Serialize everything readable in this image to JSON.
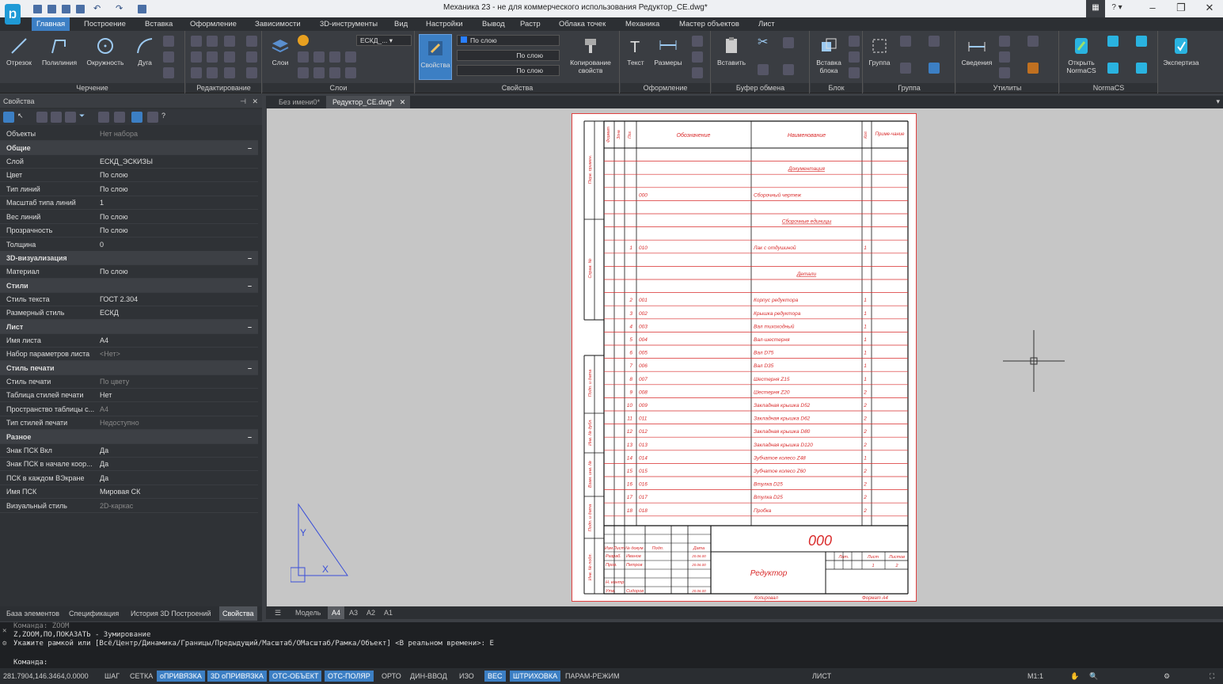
{
  "title": "Механика 23 - не для коммерческого использования Редуктор_CE.dwg*",
  "menu": [
    "Главная",
    "Построение",
    "Вставка",
    "Оформление",
    "Зависимости",
    "3D-инструменты",
    "Вид",
    "Настройки",
    "Вывод",
    "Растр",
    "Облака точек",
    "Механика",
    "Мастер объектов",
    "Лист"
  ],
  "ribbon": {
    "draw": [
      "Отрезок",
      "Полилиния",
      "Окружность",
      "Дуга"
    ],
    "layers_btn": "Слои",
    "layer_value": "ЕСКД_...",
    "prop_btn": "Свойства",
    "combo1": "По слою",
    "combo2": "По слою",
    "combo3": "По слою",
    "copy_props": "Копирование свойств",
    "text": "Текст",
    "dims": "Размеры",
    "paste": "Вставить",
    "block_insert": "Вставка блока",
    "group": "Группа",
    "info": "Сведения",
    "normacs_open": "Открыть NormaCS",
    "expertise": "Экспертиза",
    "groups": [
      "Черчение",
      "Редактирование",
      "Слои",
      "Свойства",
      "Оформление",
      "Буфер обмена",
      "Блок",
      "Группа",
      "Утилиты",
      "NormaCS"
    ]
  },
  "panel": {
    "title": "Свойства",
    "rows": [
      {
        "k": "Объекты",
        "v": "Нет набора",
        "dim": true
      },
      {
        "cat": "Общие"
      },
      {
        "k": "Слой",
        "v": "ЕСКД_ЭСКИЗЫ"
      },
      {
        "k": "Цвет",
        "v": "По слою"
      },
      {
        "k": "Тип линий",
        "v": "По слою"
      },
      {
        "k": "Масштаб типа линий",
        "v": "1"
      },
      {
        "k": "Вес линий",
        "v": "По слою"
      },
      {
        "k": "Прозрачность",
        "v": "По слою"
      },
      {
        "k": "Толщина",
        "v": "0"
      },
      {
        "cat": "3D-визуализация"
      },
      {
        "k": "Материал",
        "v": "По слою"
      },
      {
        "cat": "Стили"
      },
      {
        "k": "Стиль текста",
        "v": "ГОСТ 2.304"
      },
      {
        "k": "Размерный стиль",
        "v": "ЕСКД"
      },
      {
        "cat": "Лист"
      },
      {
        "k": "Имя листа",
        "v": "A4"
      },
      {
        "k": "Набор параметров листа",
        "v": "<Нет>",
        "dim": true
      },
      {
        "cat": "Стиль печати"
      },
      {
        "k": "Стиль печати",
        "v": "По цвету",
        "dim": true
      },
      {
        "k": "Таблица стилей печати",
        "v": "Нет"
      },
      {
        "k": "Пространство таблицы с...",
        "v": "A4",
        "dim": true
      },
      {
        "k": "Тип стилей печати",
        "v": "Недоступно",
        "dim": true
      },
      {
        "cat": "Разное"
      },
      {
        "k": "Знак ПСК Вкл",
        "v": "Да"
      },
      {
        "k": "Знак ПСК в начале коор...",
        "v": "Да"
      },
      {
        "k": "ПСК в каждом ВЭкране",
        "v": "Да"
      },
      {
        "k": "Имя ПСК",
        "v": "Мировая СК"
      },
      {
        "k": "Визуальный стиль",
        "v": "2D-каркас",
        "dim": true
      }
    ]
  },
  "bottom_tabs": [
    "База элементов",
    "Спецификация",
    "История 3D Построений",
    "Свойства"
  ],
  "doc_tabs": [
    "Без имени0*",
    "Редуктор_CE.dwg*"
  ],
  "layout_tabs": [
    "Модель",
    "A4",
    "A3",
    "A2",
    "A1"
  ],
  "spec": {
    "header": {
      "format": "Формат",
      "zone": "Зона",
      "pos": "Поз.",
      "designation": "Обозначение",
      "name": "Наименование",
      "qty": "Кол.",
      "note": "Приме-чание"
    },
    "rows": [
      {
        "type": "blank"
      },
      {
        "type": "section",
        "name": "Документация"
      },
      {
        "type": "blank"
      },
      {
        "type": "item",
        "pos": "",
        "des": "000",
        "name": "Сборочный чертеж",
        "qty": ""
      },
      {
        "type": "blank"
      },
      {
        "type": "section",
        "name": "Сборочные единицы"
      },
      {
        "type": "blank"
      },
      {
        "type": "item",
        "pos": "1",
        "des": "010",
        "name": "Лак с отдушиной",
        "qty": "1"
      },
      {
        "type": "blank"
      },
      {
        "type": "section",
        "name": "Детали"
      },
      {
        "type": "blank"
      },
      {
        "type": "item",
        "pos": "2",
        "des": "001",
        "name": "Корпус редуктора",
        "qty": "1"
      },
      {
        "type": "item",
        "pos": "3",
        "des": "002",
        "name": "Крышка редуктора",
        "qty": "1"
      },
      {
        "type": "item",
        "pos": "4",
        "des": "003",
        "name": "Вал тихоходный",
        "qty": "1"
      },
      {
        "type": "item",
        "pos": "5",
        "des": "004",
        "name": "Вал-шестерня",
        "qty": "1"
      },
      {
        "type": "item",
        "pos": "6",
        "des": "005",
        "name": "Вал D75",
        "qty": "1"
      },
      {
        "type": "item",
        "pos": "7",
        "des": "006",
        "name": "Вал D35",
        "qty": "1"
      },
      {
        "type": "item",
        "pos": "8",
        "des": "007",
        "name": "Шестерня Z15",
        "qty": "1"
      },
      {
        "type": "item",
        "pos": "9",
        "des": "008",
        "name": "Шестерня Z20",
        "qty": "2"
      },
      {
        "type": "item",
        "pos": "10",
        "des": "009",
        "name": "Закладная крышка D52",
        "qty": "2"
      },
      {
        "type": "item",
        "pos": "11",
        "des": "011",
        "name": "Закладная крышка D62",
        "qty": "2"
      },
      {
        "type": "item",
        "pos": "12",
        "des": "012",
        "name": "Закладная крышка D80",
        "qty": "2"
      },
      {
        "type": "item",
        "pos": "13",
        "des": "013",
        "name": "Закладная крышка D120",
        "qty": "2"
      },
      {
        "type": "item",
        "pos": "14",
        "des": "014",
        "name": "Зубчатое колесо Z48",
        "qty": "1"
      },
      {
        "type": "item",
        "pos": "15",
        "des": "015",
        "name": "Зубчатое колесо Z60",
        "qty": "2"
      },
      {
        "type": "item",
        "pos": "16",
        "des": "016",
        "name": "Втулка D25",
        "qty": "2"
      },
      {
        "type": "item",
        "pos": "17",
        "des": "017",
        "name": "Втулка D25",
        "qty": "2"
      },
      {
        "type": "item",
        "pos": "18",
        "des": "018",
        "name": "Пробка",
        "qty": "2"
      }
    ],
    "side": [
      "Перв. примен.",
      "Справ. №",
      "Подп. и дата",
      "Инв. № дубл.",
      "Взам. инв. №",
      "Подп. и дата",
      "Инв. № подл."
    ],
    "stamp": {
      "code": "000",
      "title": "Редуктор",
      "cols": [
        "Изм",
        "Лист",
        "№ докум.",
        "Подп.",
        "Дата"
      ],
      "roles": [
        {
          "r": "Разраб.",
          "n": "Иванов",
          "d": "20.06.00"
        },
        {
          "r": "Пров.",
          "n": "Петров",
          "d": "20.06.00"
        },
        {
          "r": "",
          "n": "",
          "d": ""
        },
        {
          "r": "Н. контр.",
          "n": "",
          "d": ""
        },
        {
          "r": "Утв.",
          "n": "Сидоров",
          "d": "20.06.00"
        }
      ],
      "lit": "Лит.",
      "sheet": "Лист",
      "sheets": "Листов",
      "sheet_no": "1",
      "sheets_no": "2",
      "copied": "Копировал",
      "format": "Формат A4"
    }
  },
  "command": {
    "line1": "Команда: ZOOM",
    "line2": "Z,ZOOM,ПО,ПОКАЗАТЬ - Зумирование",
    "line3": "Укажите рамкой или [Всё/Центр/Динамика/Границы/Предыдущий/Масштаб/ОМасштаб/Рамка/Объект] <В реальном времени>: E",
    "prompt": "Команда:"
  },
  "status": {
    "coords": "281.7904,146.3464,0.0000",
    "items": [
      {
        "t": "ШАГ",
        "on": false
      },
      {
        "t": "СЕТКА",
        "on": false
      },
      {
        "t": "оПРИВЯЗКА",
        "on": true
      },
      {
        "t": "3D оПРИВЯЗКА",
        "on": true
      },
      {
        "t": "ОТС-ОБЪЕКТ",
        "on": true
      },
      {
        "t": "ОТС-ПОЛЯР",
        "on": true
      },
      {
        "t": "ОРТО",
        "on": false
      },
      {
        "t": "ДИН-ВВОД",
        "on": false
      },
      {
        "t": "ИЗО",
        "on": false
      },
      {
        "t": "ВЕС",
        "on": true
      },
      {
        "t": "ШТРИХОВКА",
        "on": true
      },
      {
        "t": "ПАРАМ-РЕЖИМ",
        "on": false
      }
    ],
    "sheet": "ЛИСТ",
    "scale": "М1:1"
  }
}
